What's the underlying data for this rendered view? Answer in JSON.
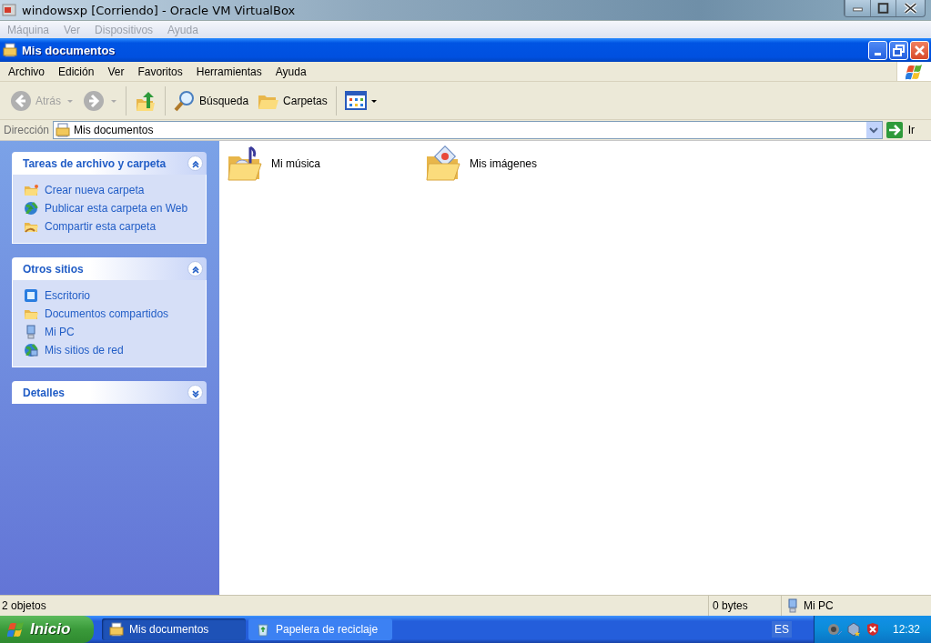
{
  "host": {
    "title": "windowsxp [Corriendo] - Oracle VM VirtualBox",
    "menu": [
      {
        "label": "Máquina",
        "disabled": true
      },
      {
        "label": "Ver",
        "disabled": true
      },
      {
        "label": "Dispositivos",
        "disabled": true
      },
      {
        "label": "Ayuda",
        "disabled": true
      }
    ]
  },
  "window": {
    "title": "Mis documentos",
    "menu": [
      "Archivo",
      "Edición",
      "Ver",
      "Favoritos",
      "Herramientas",
      "Ayuda"
    ]
  },
  "toolbar": [
    {
      "kind": "back",
      "label": "Atrás",
      "disabled": true
    },
    {
      "kind": "forward",
      "disabled": true
    },
    {
      "kind": "up",
      "disabled": false
    },
    {
      "kind": "search",
      "label": "Búsqueda",
      "disabled": false
    },
    {
      "kind": "folders",
      "label": "Carpetas",
      "disabled": false
    },
    {
      "kind": "views",
      "disabled": false
    }
  ],
  "address": {
    "label": "Dirección",
    "value": "Mis documentos",
    "go": "Ir"
  },
  "sidebar": [
    {
      "title": "Tareas de archivo y carpeta",
      "expanded": true,
      "items": [
        "Crear nueva carpeta",
        "Publicar esta carpeta en Web",
        "Compartir esta carpeta"
      ]
    },
    {
      "title": "Otros sitios",
      "expanded": true,
      "items": [
        "Escritorio",
        "Documentos compartidos",
        "Mi PC",
        "Mis sitios de red"
      ]
    },
    {
      "title": "Detalles",
      "expanded": false
    }
  ],
  "files": [
    {
      "label": "Mi música",
      "kind": "music"
    },
    {
      "label": "Mis imágenes",
      "kind": "pictures"
    }
  ],
  "status_bar": {
    "count": "2 objetos",
    "size": "0 bytes",
    "zone": "Mi PC"
  },
  "taskbar": {
    "start": "Inicio",
    "tasks": [
      {
        "label": "Mis documentos",
        "selected": true
      },
      {
        "label": "Papelera de reciclaje",
        "selected": false
      }
    ],
    "language": "ES",
    "clock": "12:32"
  }
}
